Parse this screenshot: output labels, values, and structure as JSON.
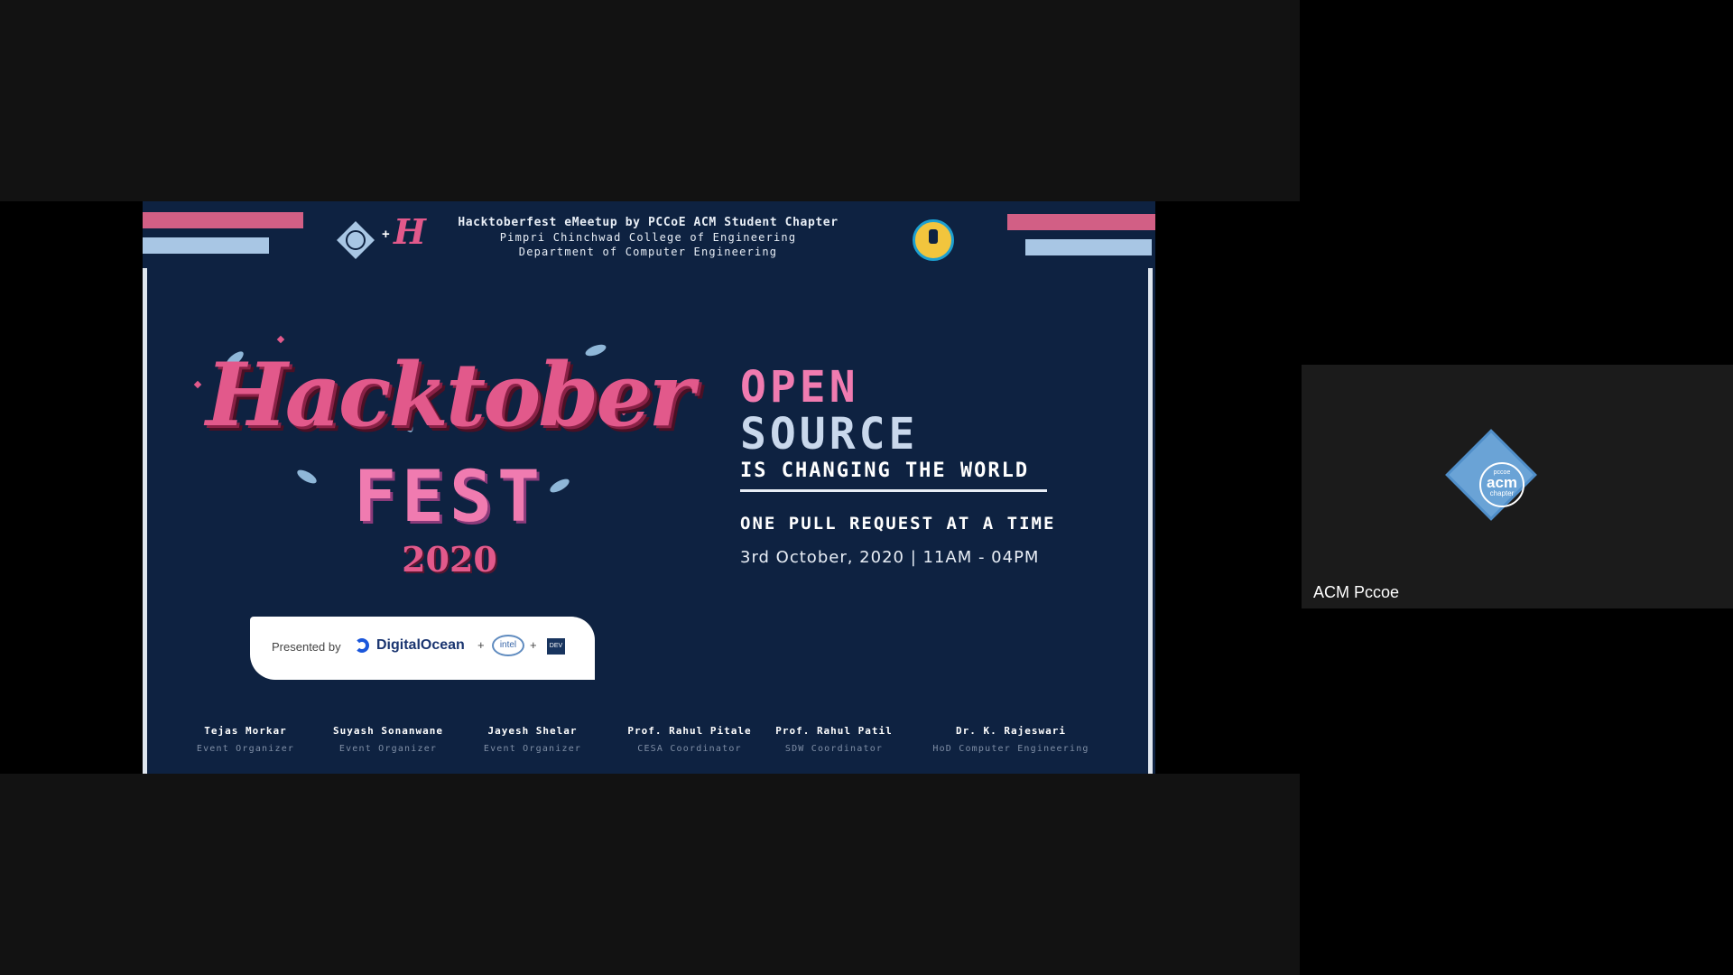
{
  "slide": {
    "header": {
      "line1": "Hacktoberfest eMeetup by PCCoE ACM Student Chapter",
      "line2": "Pimpri Chinchwad College of Engineering",
      "line3": "Department of Computer Engineering",
      "plus": "+",
      "h_mark": "H"
    },
    "title_script": "Hacktober",
    "fest": "FEST",
    "year": "2020",
    "tagline": {
      "open": "OPEN",
      "source": "SOURCE",
      "changing": "IS CHANGING THE WORLD",
      "pull": "ONE PULL REQUEST AT A TIME",
      "date": "3rd October, 2020 | 11AM - 04PM"
    },
    "presented": {
      "prefix": "Presented by",
      "sponsor1": "DigitalOcean",
      "plus": "+",
      "sponsor2": "intel",
      "sponsor3": "DEV"
    },
    "people": [
      {
        "name": "Tejas Morkar",
        "role": "Event Organizer"
      },
      {
        "name": "Suyash Sonanwane",
        "role": "Event Organizer"
      },
      {
        "name": "Jayesh Shelar",
        "role": "Event Organizer"
      },
      {
        "name": "Prof. Rahul Pitale",
        "role": "CESA Coordinator"
      },
      {
        "name": "Prof. Rahul Patil",
        "role": "SDW Coordinator"
      },
      {
        "name": "Dr. K. Rajeswari",
        "role": "HoD Computer Engineering"
      }
    ]
  },
  "participant": {
    "name": "ACM Pccoe",
    "logo_top": "pccoe",
    "logo_mid": "acm",
    "logo_bot": "chapter"
  },
  "colors": {
    "slide_bg": "#0e2241",
    "pink": "#e2598b",
    "light_blue": "#a8c6e4"
  }
}
